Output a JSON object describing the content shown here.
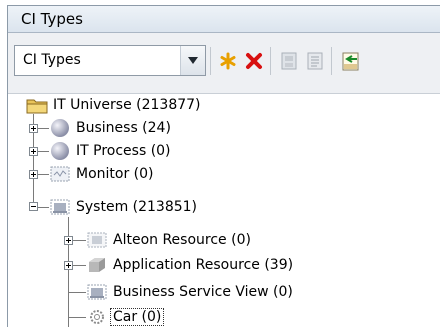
{
  "panel": {
    "title": "CI Types"
  },
  "toolbar": {
    "combo_value": "CI Types",
    "buttons": [
      {
        "name": "new-ci-type-button",
        "icon": "asterisk-icon"
      },
      {
        "name": "delete-button",
        "icon": "red-x-icon"
      },
      {
        "name": "properties-button",
        "icon": "properties-icon"
      },
      {
        "name": "details-button",
        "icon": "details-icon"
      },
      {
        "name": "export-xml-button",
        "icon": "xml-export-icon"
      }
    ]
  },
  "tree": {
    "root": "IT Universe (213877)",
    "business": "Business (24)",
    "it_process": "IT Process (0)",
    "monitor": "Monitor (0)",
    "system": "System (213851)",
    "alteon": "Alteon Resource (0)",
    "application": "Application Resource (39)",
    "bsv": "Business Service View (0)",
    "car": "Car (0)"
  },
  "colors": {
    "accent": "#e8a000",
    "delete": "#d81010",
    "folder": "#e9c45a"
  }
}
